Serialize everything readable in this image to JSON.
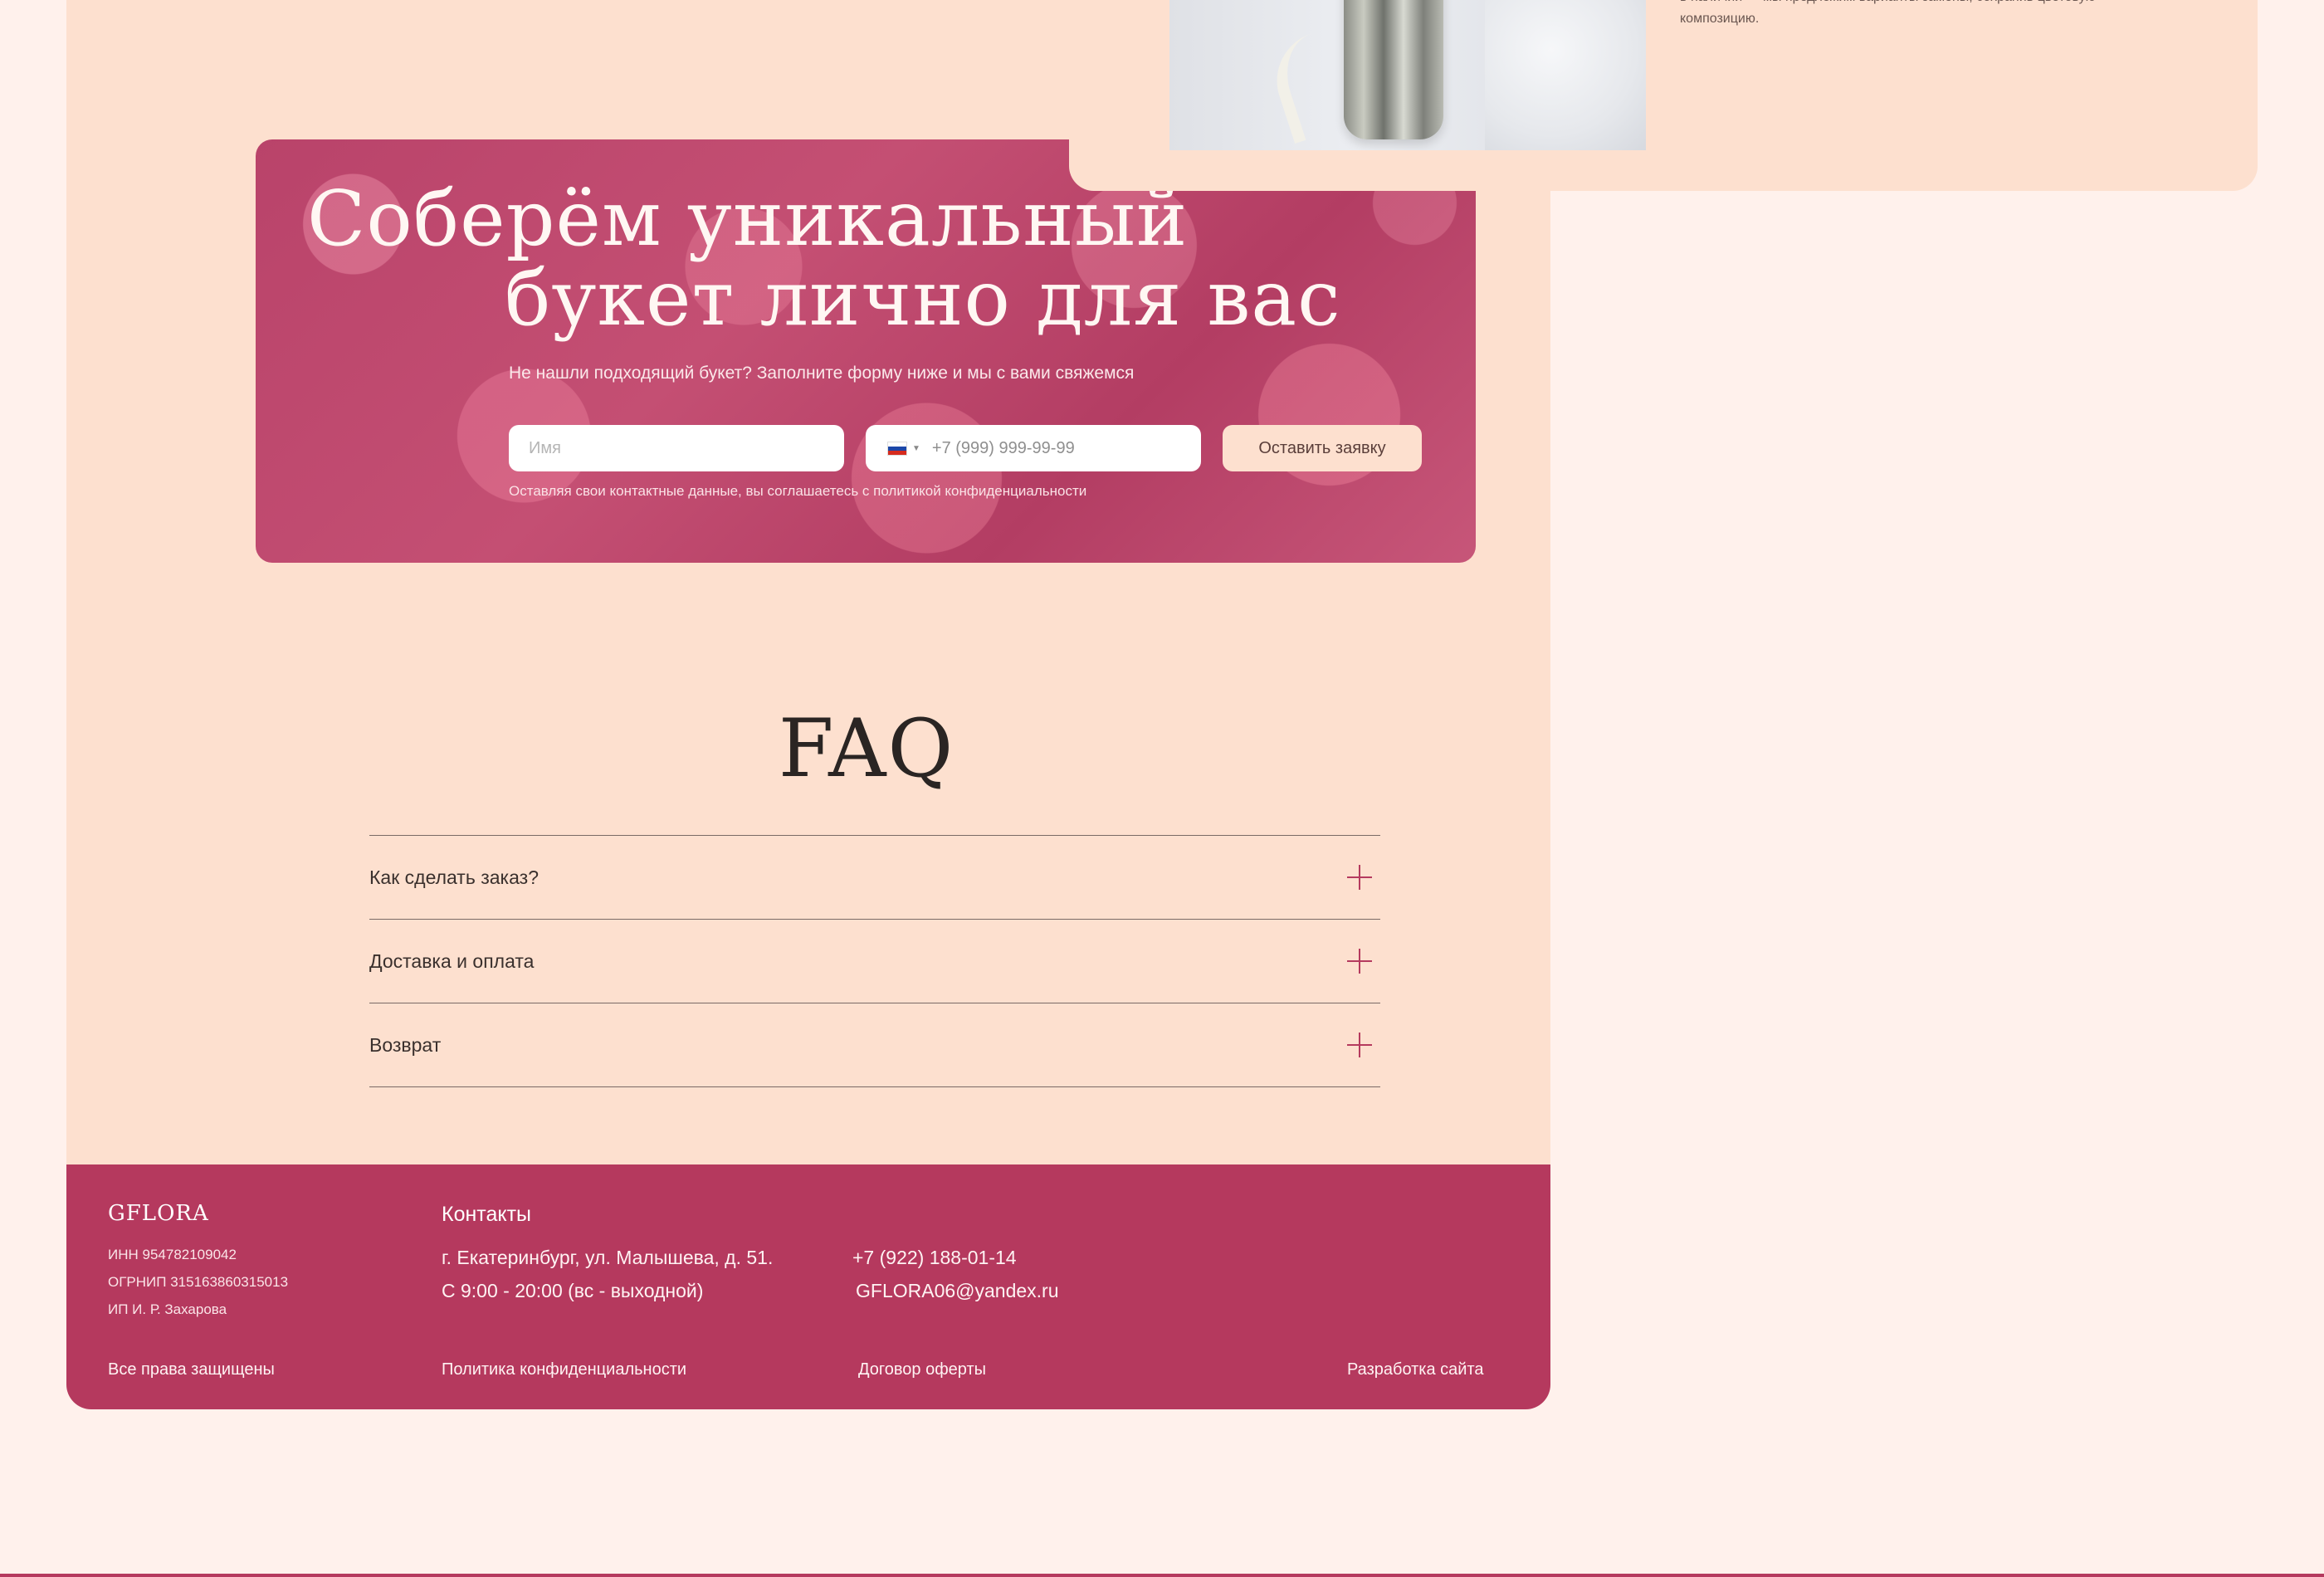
{
  "top_card": {
    "text": "в наличии — мы предложим варианты замены, сохранив цветовую композицию."
  },
  "hero": {
    "title_line1": "Соберём уникальный",
    "title_line2": "букет лично для вас",
    "subtitle": "Не нашли подходящий букет? Заполните форму ниже и мы с вами свяжемся",
    "name_placeholder": "Имя",
    "phone_placeholder": "+7 (999) 999-99-99",
    "submit_label": "Оставить заявку",
    "consent": "Оставляя свои контактные данные, вы соглашаетесь с политикой конфиденциальности"
  },
  "faq": {
    "title": "FAQ",
    "items": [
      {
        "question": "Как сделать заказ?"
      },
      {
        "question": "Доставка и оплата"
      },
      {
        "question": "Возврат"
      }
    ]
  },
  "footer": {
    "logo": "GFLORA",
    "inn": "ИНН 954782109042",
    "ogrnip": "ОГРНИП 315163860315013",
    "ip": "ИП И. Р. Захарова",
    "contacts_title": "Контакты",
    "address": "г. Екатеринбург, ул. Малышева, д. 51.",
    "hours": "С 9:00 - 20:00 (вс - выходной)",
    "phone": "+7 (922) 188-01-14",
    "email": "GFLORA06@yandex.ru",
    "rights": "Все права защищены",
    "privacy": "Политика конфиденциальности",
    "offer": "Договор оферты",
    "dev": "Разработка сайта"
  },
  "colors": {
    "page_bg": "#fff1ec",
    "panel_bg": "#fde0cf",
    "accent": "#b5395e",
    "hero_bg": "#c04a6f"
  },
  "icons": {
    "faq_toggle": "plus-icon",
    "phone_country": "russia-flag-icon"
  }
}
